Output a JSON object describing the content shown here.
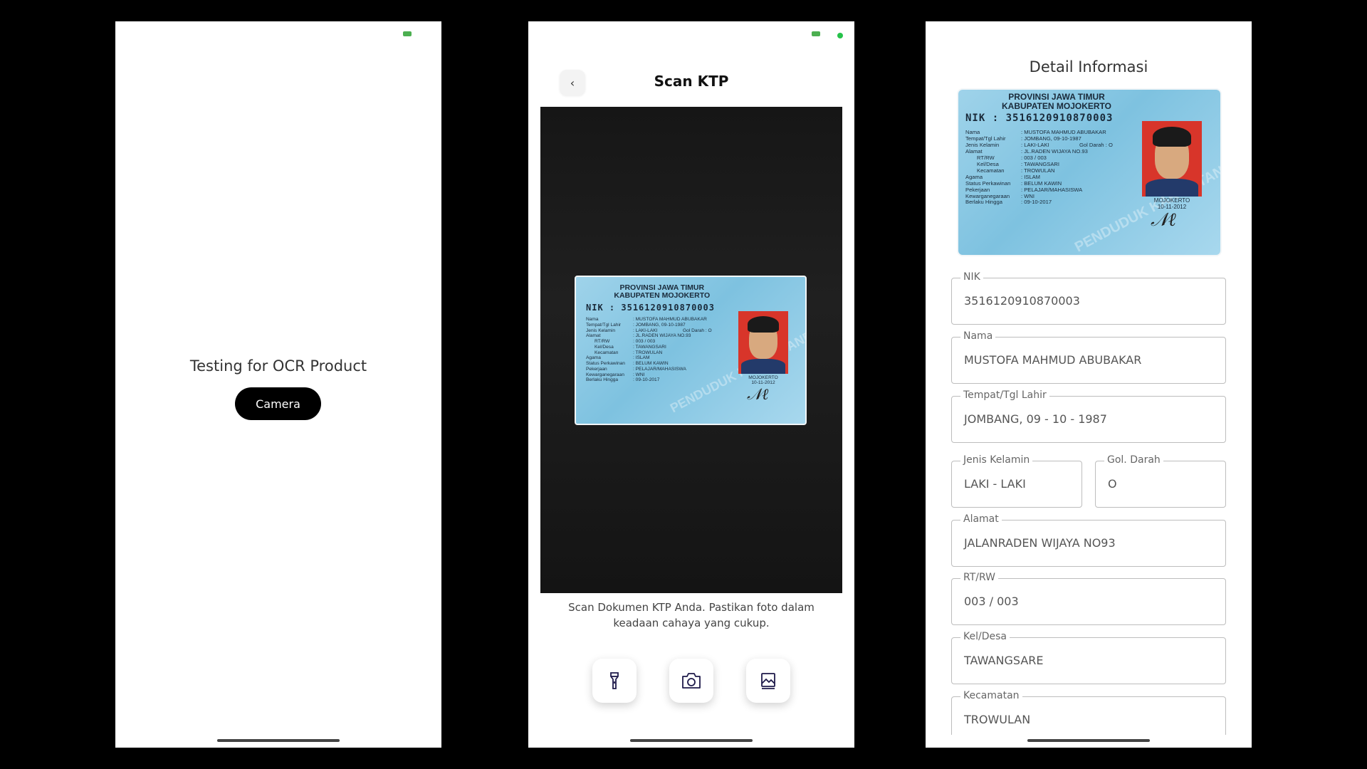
{
  "screen1": {
    "title": "Testing for OCR Product",
    "camera_button": "Camera"
  },
  "screen2": {
    "title": "Scan KTP",
    "back_icon": "chevron-left-icon",
    "hint": "Scan Dokumen KTP Anda. Pastikan foto dalam keadaan cahaya yang cukup.",
    "actions": [
      {
        "name": "flashlight-button",
        "icon": "flashlight-icon"
      },
      {
        "name": "capture-button",
        "icon": "camera-icon"
      },
      {
        "name": "gallery-button",
        "icon": "gallery-icon"
      }
    ]
  },
  "ktp": {
    "province": "PROVINSI JAWA TIMUR",
    "regency": "KABUPATEN MOJOKERTO",
    "nik_label": "NIK",
    "nik": ": 3516120910870003",
    "rows": [
      {
        "k": "Nama",
        "v": ": MUSTOFA MAHMUD ABUBAKAR"
      },
      {
        "k": "Tempat/Tgl Lahir",
        "v": ": JOMBANG, 09-10-1987"
      },
      {
        "k": "Jenis Kelamin",
        "v": ": LAKI-LAKI",
        "extra": "Gol Darah  : O"
      },
      {
        "k": "Alamat",
        "v": ": JL.RADEN WIJAYA NO.93"
      },
      {
        "k": "RT/RW",
        "v": ": 003 / 003"
      },
      {
        "k": "Kel/Desa",
        "v": ": TAWANGSARI"
      },
      {
        "k": "Kecamatan",
        "v": ": TROWULAN"
      },
      {
        "k": "Agama",
        "v": ": ISLAM"
      },
      {
        "k": "Status Perkawinan",
        "v": ": BELUM KAWIN"
      },
      {
        "k": "Pekerjaan",
        "v": ": PELAJAR/MAHASISWA"
      },
      {
        "k": "Kewarganegaraan",
        "v": ": WNI"
      },
      {
        "k": "Berlaku Hingga",
        "v": ": 09-10-2017"
      }
    ],
    "issue_place": "MOJOKERTO",
    "issue_date": "10-11-2012",
    "watermark": "PENDUDUK KARTU TANDA"
  },
  "screen3": {
    "title": "Detail Informasi",
    "fields": {
      "nik": {
        "label": "NIK",
        "value": "3516120910870003"
      },
      "nama": {
        "label": "Nama",
        "value": "MUSTOFA MAHMUD ABUBAKAR"
      },
      "ttl": {
        "label": "Tempat/Tgl Lahir",
        "value": "JOMBANG, 09 -  10 - 1987"
      },
      "jk": {
        "label": "Jenis Kelamin",
        "value": "LAKI - LAKI"
      },
      "gol": {
        "label": "Gol. Darah",
        "value": "O"
      },
      "alamat": {
        "label": "Alamat",
        "value": "JALANRADEN WIJAYA NO93"
      },
      "rtrw": {
        "label": "RT/RW",
        "value": "003 / 003"
      },
      "kel": {
        "label": "Kel/Desa",
        "value": "TAWANGSARE"
      },
      "kec": {
        "label": "Kecamatan",
        "value": "TROWULAN"
      }
    }
  },
  "colors": {
    "primary": "#000000",
    "status_green": "#26c24a",
    "card_blue": "#8fcbe6",
    "photo_red": "#d8352a"
  }
}
